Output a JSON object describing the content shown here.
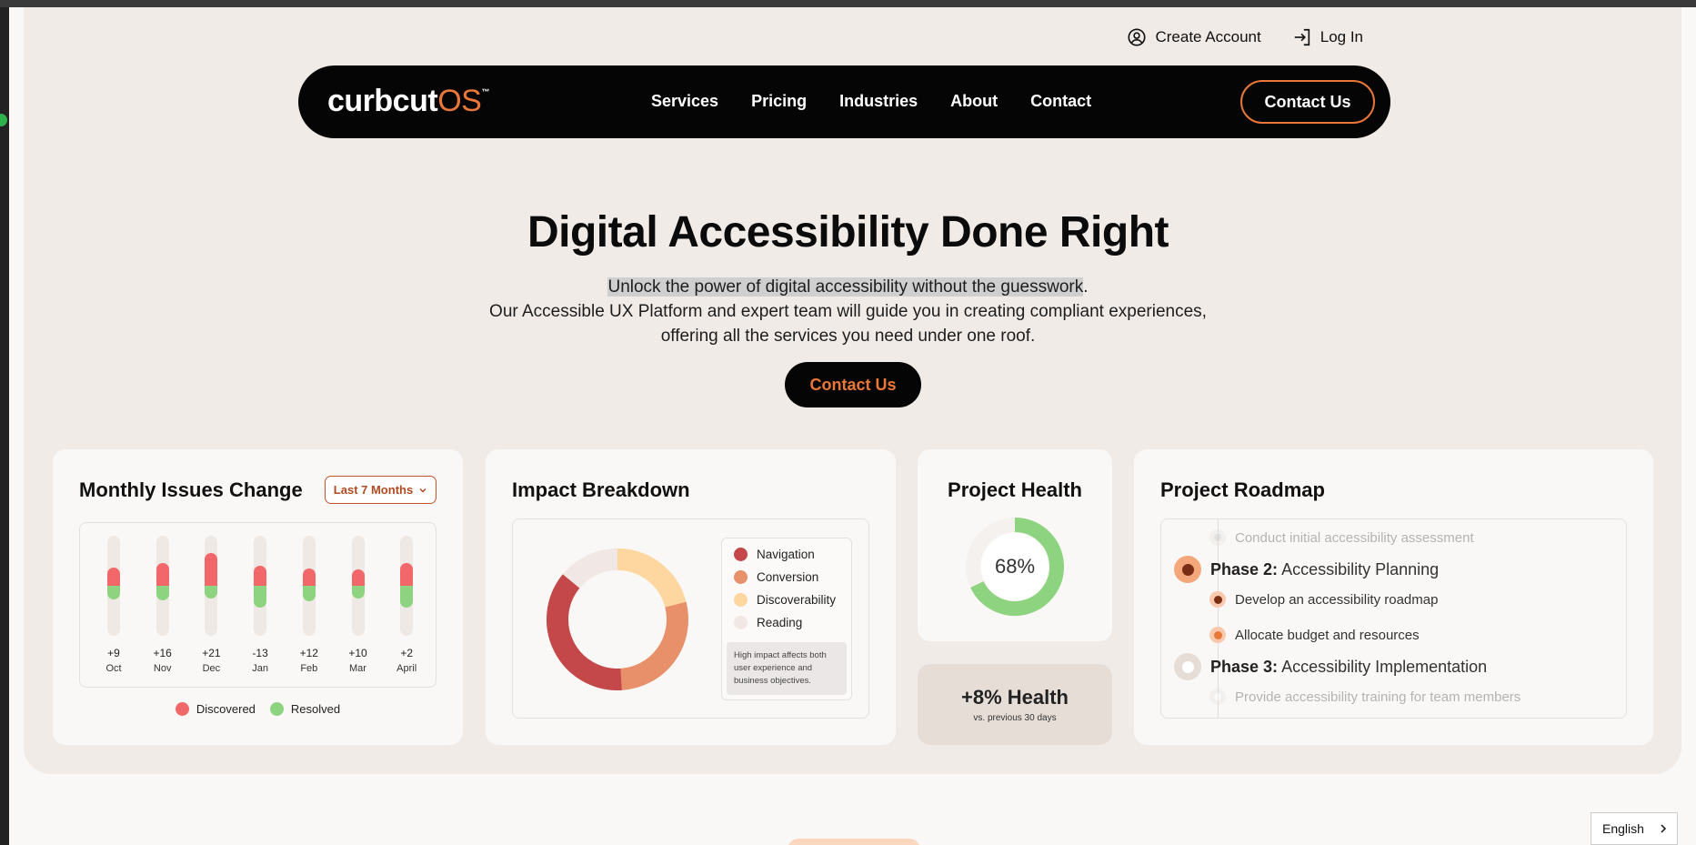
{
  "header": {
    "create_account": "Create Account",
    "log_in": "Log In"
  },
  "nav": {
    "logo_main": "curbcut",
    "logo_accent": "OS",
    "logo_tm": "™",
    "links": [
      "Services",
      "Pricing",
      "Industries",
      "About",
      "Contact"
    ],
    "cta": "Contact Us"
  },
  "hero": {
    "title": "Digital Accessibility Done Right",
    "sub_line1_highlighted": "Unlock the power of digital accessibility without the guesswork",
    "sub_line1_end": ".",
    "sub_line2": "Our Accessible UX Platform and expert team will guide you in creating compliant experiences,",
    "sub_line3": "offering all the services you need under one roof.",
    "cta": "Contact Us"
  },
  "monthly": {
    "title": "Monthly Issues Change",
    "dropdown": "Last 7 Months",
    "legend_discovered": "Discovered",
    "legend_resolved": "Resolved",
    "colors": {
      "discovered": "#f2686a",
      "resolved": "#8ed37f"
    },
    "bars": [
      {
        "month": "Oct",
        "change": "+9",
        "discovered": 20,
        "resolved": 15
      },
      {
        "month": "Nov",
        "change": "+16",
        "discovered": 25,
        "resolved": 16
      },
      {
        "month": "Dec",
        "change": "+21",
        "discovered": 36,
        "resolved": 14
      },
      {
        "month": "Jan",
        "change": "-13",
        "discovered": 22,
        "resolved": 24
      },
      {
        "month": "Feb",
        "change": "+12",
        "discovered": 19,
        "resolved": 17
      },
      {
        "month": "Mar",
        "change": "+10",
        "discovered": 18,
        "resolved": 14
      },
      {
        "month": "April",
        "change": "+2",
        "discovered": 25,
        "resolved": 24
      }
    ]
  },
  "impact": {
    "title": "Impact Breakdown",
    "segments": [
      {
        "label": "Navigation",
        "color": "#c4474a",
        "share": 0.37
      },
      {
        "label": "Conversion",
        "color": "#e8906a",
        "share": 0.28
      },
      {
        "label": "Discoverability",
        "color": "#fdd6a0",
        "share": 0.21
      },
      {
        "label": "Reading",
        "color": "#f1e7e5",
        "share": 0.14
      }
    ],
    "note": "High impact affects both user experience and business objectives."
  },
  "health": {
    "title": "Project Health",
    "percent_label": "68%",
    "percent": 68,
    "color": "#8ed37f",
    "change": "+8% Health",
    "change_sub": "vs. previous 30 days"
  },
  "roadmap": {
    "title": "Project Roadmap",
    "task0": "Conduct initial accessibility assessment",
    "phase2_label": "Phase 2:",
    "phase2_name": "Accessibility Planning",
    "task1": "Develop an accessibility roadmap",
    "task2": "Allocate budget and resources",
    "phase3_label": "Phase 3:",
    "phase3_name": "Accessibility Implementation",
    "task3": "Provide accessibility training for team members"
  },
  "language": {
    "current": "English"
  }
}
